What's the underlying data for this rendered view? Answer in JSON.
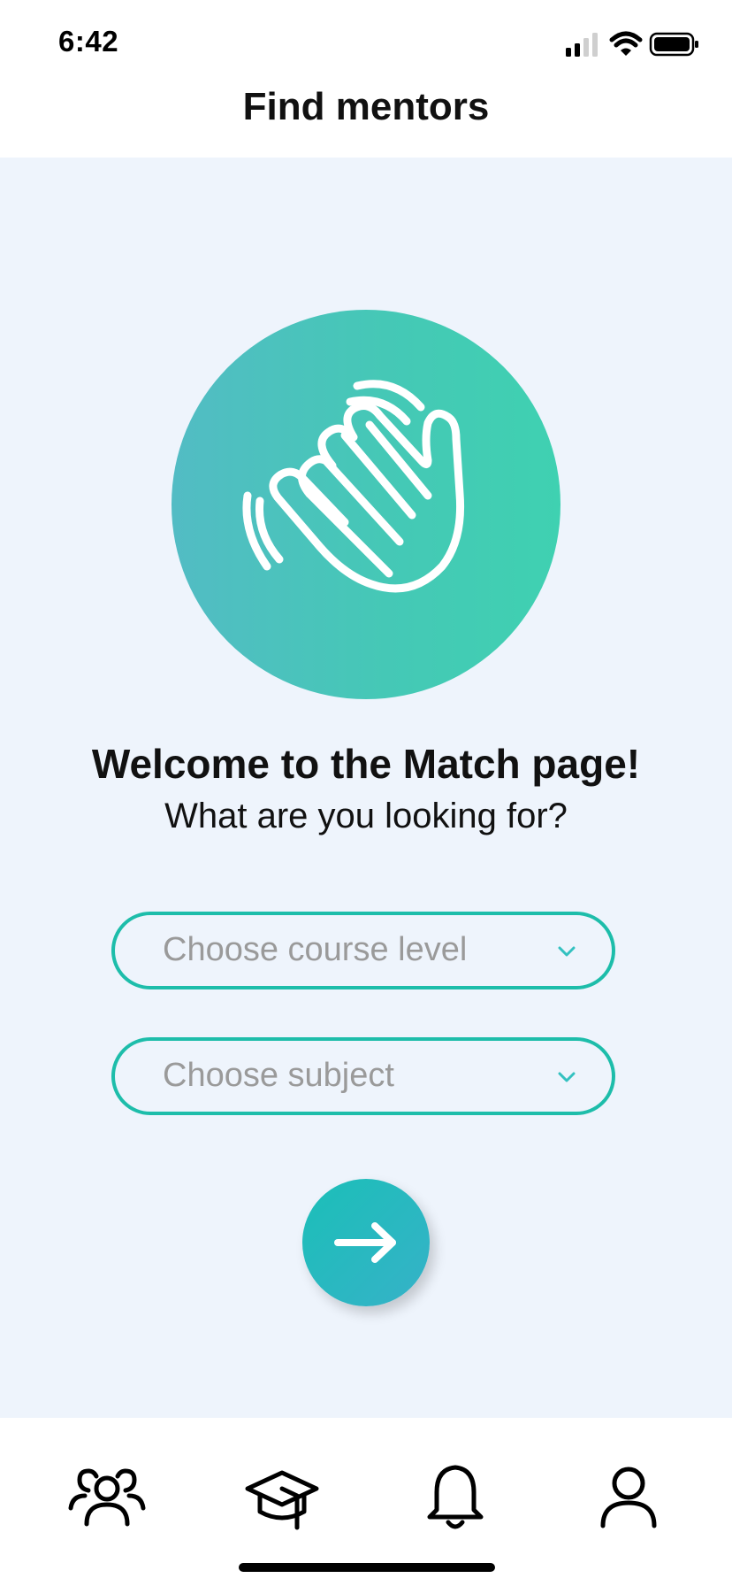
{
  "status_bar": {
    "time": "6:42"
  },
  "header": {
    "title": "Find mentors"
  },
  "main": {
    "hero_icon": "waving-hand-icon",
    "welcome_title": "Welcome to the Match page!",
    "welcome_subtitle": "What are you looking for?",
    "course_level_select": {
      "placeholder": "Choose course level"
    },
    "subject_select": {
      "placeholder": "Choose subject"
    },
    "next_button_icon": "arrow-right-icon"
  },
  "tab_bar": {
    "items": [
      {
        "icon": "people-icon"
      },
      {
        "icon": "graduation-cap-icon"
      },
      {
        "icon": "bell-icon"
      },
      {
        "icon": "user-icon"
      }
    ]
  },
  "colors": {
    "accent": "#1dbdaa",
    "background": "#eef4fc",
    "circle_start": "#52bcc4",
    "circle_end": "#3fd1b1"
  }
}
